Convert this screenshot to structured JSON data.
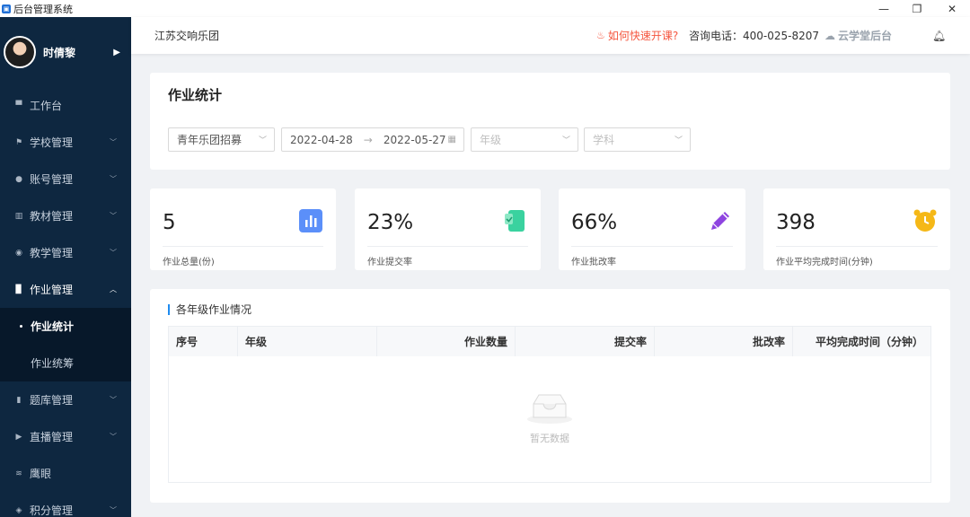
{
  "window": {
    "title": "后台管理系统",
    "min_glyph": "—",
    "restore_glyph": "❐",
    "close_glyph": "✕"
  },
  "sidebar": {
    "user_name": "时倩黎",
    "items": [
      {
        "label": "工作台",
        "icon": "monitor-icon",
        "expandable": false
      },
      {
        "label": "学校管理",
        "icon": "flag-icon",
        "expandable": true
      },
      {
        "label": "账号管理",
        "icon": "user-icon",
        "expandable": true
      },
      {
        "label": "教材管理",
        "icon": "book-icon",
        "expandable": true
      },
      {
        "label": "教学管理",
        "icon": "teacher-icon",
        "expandable": true
      },
      {
        "label": "作业管理",
        "icon": "homework-icon",
        "expandable": true,
        "open": true,
        "children": [
          {
            "label": "作业统计",
            "active": true
          },
          {
            "label": "作业统筹",
            "active": false
          }
        ]
      },
      {
        "label": "题库管理",
        "icon": "question-bank-icon",
        "expandable": true
      },
      {
        "label": "直播管理",
        "icon": "live-icon",
        "expandable": true
      },
      {
        "label": "鹰眼",
        "icon": "eagle-eye-icon",
        "expandable": false
      },
      {
        "label": "积分管理",
        "icon": "points-icon",
        "expandable": true
      }
    ]
  },
  "header": {
    "org_name": "江苏交响乐团",
    "help_link": "如何快速开课?",
    "phone": "咨询电话：400-025-8207",
    "brand": "云学堂后台"
  },
  "filters": {
    "page_title": "作业统计",
    "org_select": "青年乐团招募",
    "date_start": "2022-04-28",
    "date_end": "2022-05-27",
    "grade_placeholder": "年级",
    "subject_placeholder": "学科"
  },
  "stats": [
    {
      "value": "5",
      "label": "作业总量(份)",
      "icon": "bar-chart-icon",
      "color": "#5b8ff9"
    },
    {
      "value": "23%",
      "label": "作业提交率",
      "icon": "submit-icon",
      "color": "#3ad29f"
    },
    {
      "value": "66%",
      "label": "作业批改率",
      "icon": "pencil-icon",
      "color": "#8e44e0"
    },
    {
      "value": "398",
      "label": "作业平均完成时间(分钟)",
      "icon": "alarm-clock-icon",
      "color": "#f5b817"
    }
  ],
  "grade_table": {
    "title": "各年级作业情况",
    "columns": [
      "序号",
      "年级",
      "作业数量",
      "提交率",
      "批改率",
      "平均完成时间（分钟）"
    ],
    "rows": [],
    "empty_text": "暂无数据"
  },
  "colors": {
    "sidebar_bg": "#0e2740",
    "accent": "#1f8cf0",
    "help_link": "#f5563f"
  }
}
